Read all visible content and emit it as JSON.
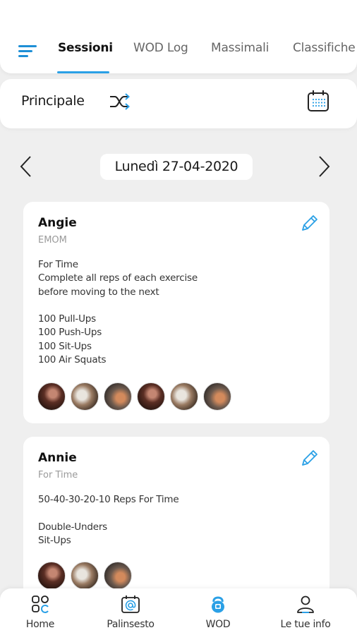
{
  "header": {
    "tabs": [
      {
        "label": "Sessioni",
        "active": true
      },
      {
        "label": "WOD Log",
        "active": false
      },
      {
        "label": "Massimali",
        "active": false
      },
      {
        "label": "Classifiche",
        "active": false
      }
    ]
  },
  "subbar": {
    "title": "Principale"
  },
  "date_nav": {
    "date": "Lunedì 27-04-2020"
  },
  "wods": [
    {
      "title": "Angie",
      "type": "EMOM",
      "description": "For Time\nComplete all reps of each exercise\nbefore moving to the next\n\n100 Pull-Ups\n100 Push-Ups\n100 Sit-Ups\n100 Air Squats",
      "participants": 6
    },
    {
      "title": "Annie",
      "type": "For Time",
      "description": "50-40-30-20-10 Reps For Time\n\nDouble-Unders\nSit-Ups",
      "participants": 3
    }
  ],
  "bottom_nav": [
    {
      "label": "Home",
      "icon": "home-grid-icon",
      "active": false
    },
    {
      "label": "Palinsesto",
      "icon": "calendar-at-icon",
      "active": false
    },
    {
      "label": "WOD",
      "icon": "kettlebell-icon",
      "active": true
    },
    {
      "label": "Le tue info",
      "icon": "user-icon",
      "active": false
    }
  ],
  "colors": {
    "accent": "#2aa0e6",
    "background": "#efefef",
    "card": "#ffffff"
  }
}
